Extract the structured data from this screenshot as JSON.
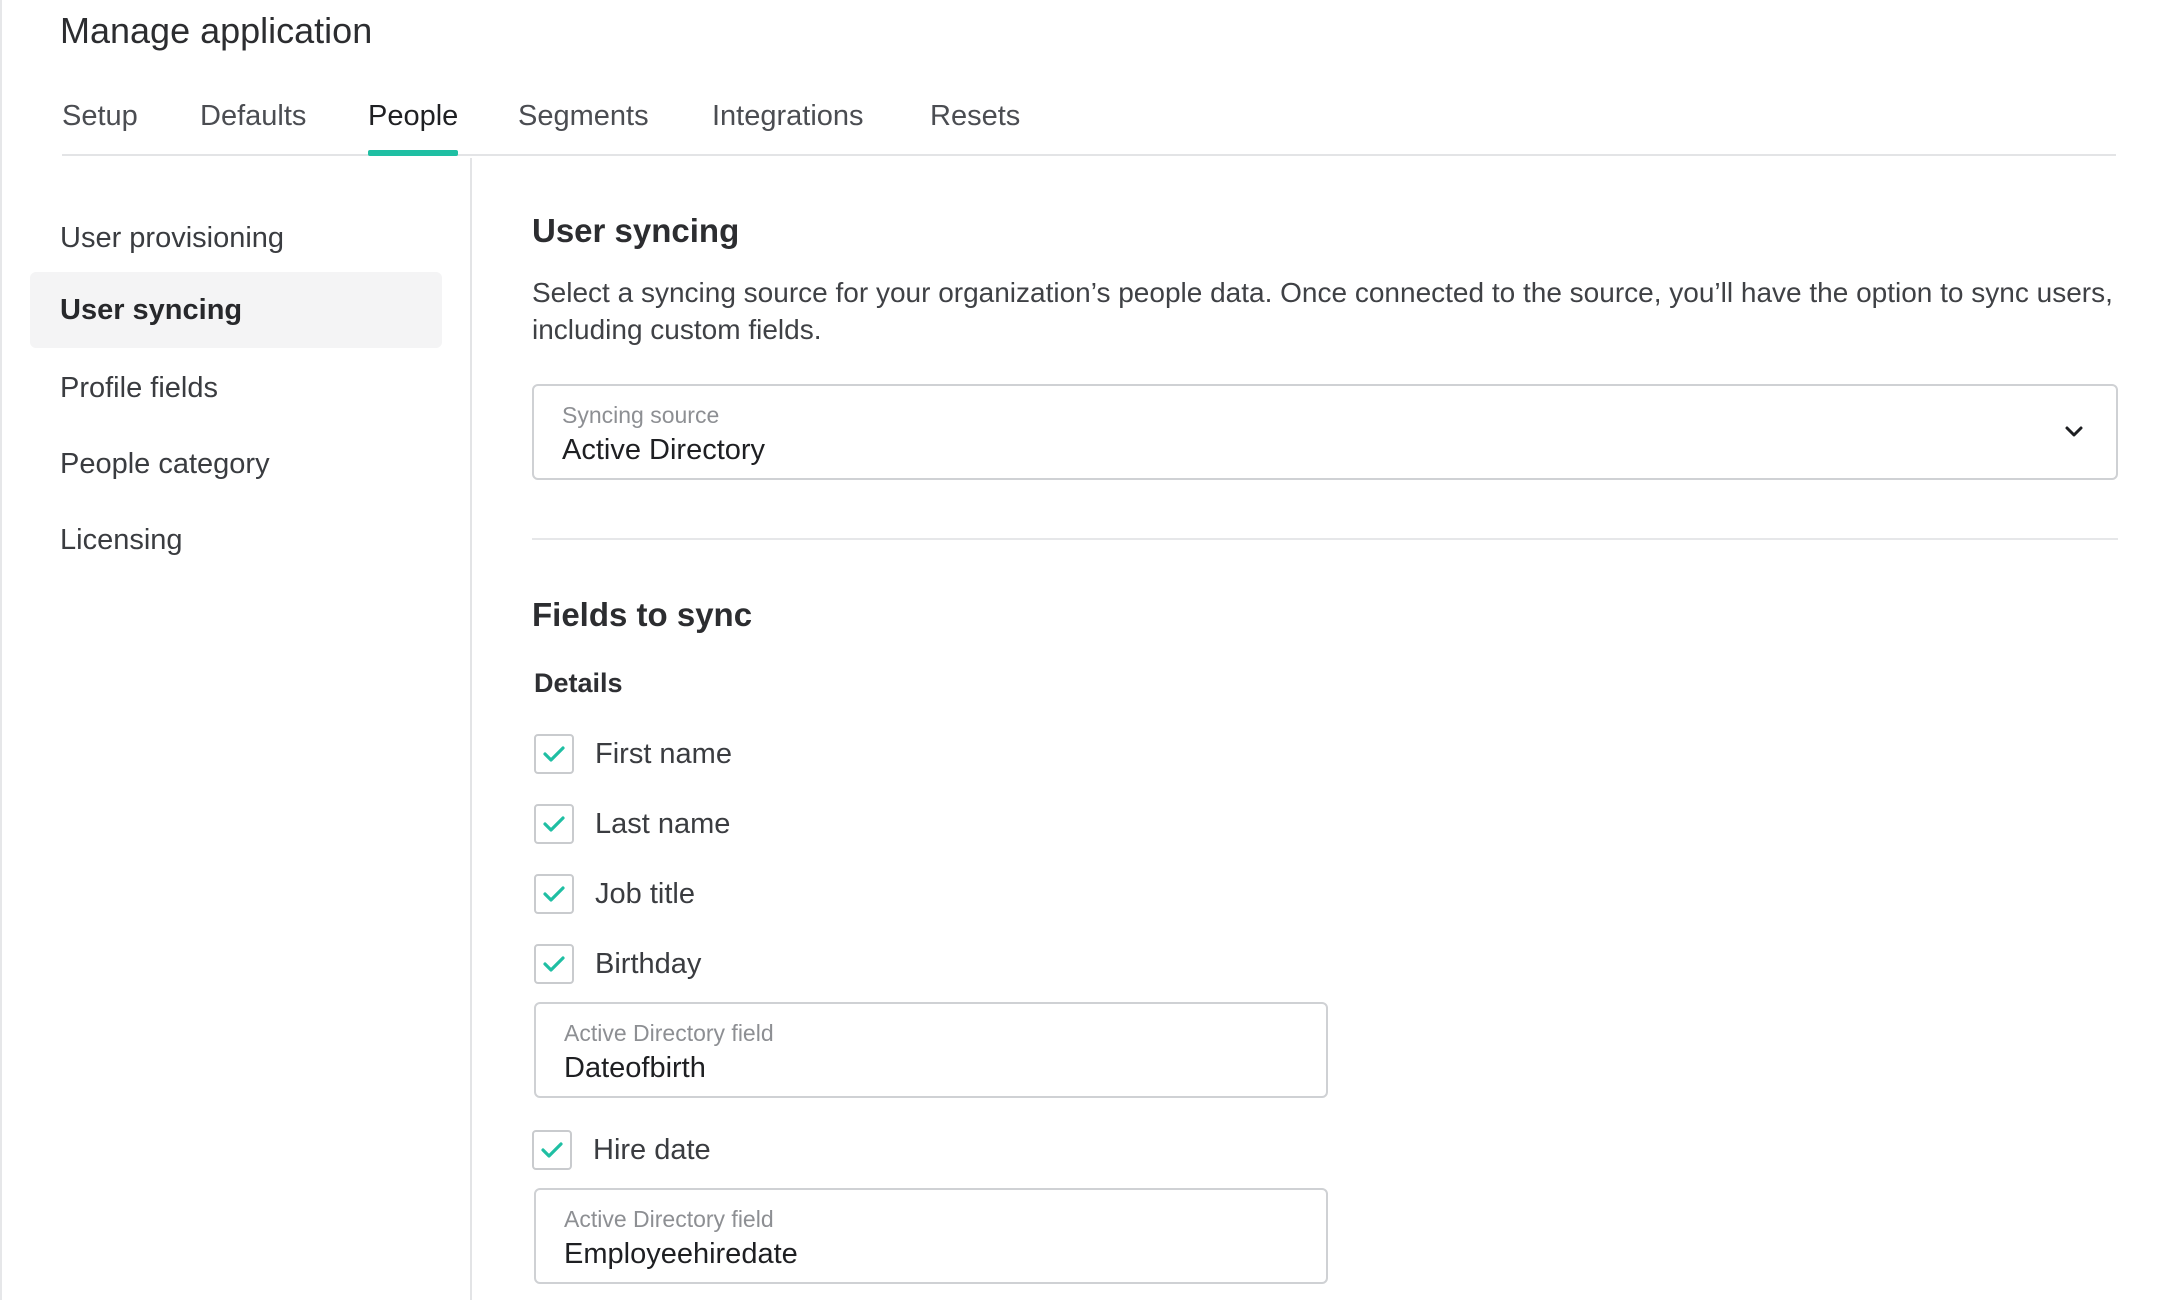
{
  "page": {
    "title": "Manage application"
  },
  "tabs": [
    {
      "label": "Setup"
    },
    {
      "label": "Defaults"
    },
    {
      "label": "People"
    },
    {
      "label": "Segments"
    },
    {
      "label": "Integrations"
    },
    {
      "label": "Resets"
    }
  ],
  "active_tab": "People",
  "sidebar": {
    "items": [
      {
        "label": "User provisioning"
      },
      {
        "label": "User syncing"
      },
      {
        "label": "Profile fields"
      },
      {
        "label": "People category"
      },
      {
        "label": "Licensing"
      }
    ],
    "active_item": "User syncing"
  },
  "user_syncing": {
    "title": "User syncing",
    "description": "Select a syncing source for your organization’s people data. Once connected to the source, you’ll have the option to sync users, including custom fields.",
    "source_label": "Syncing source",
    "source_value": "Active Directory"
  },
  "fields_to_sync": {
    "title": "Fields to sync",
    "details_label": "Details",
    "checkboxes": [
      {
        "label": "First name",
        "checked": true
      },
      {
        "label": "Last name",
        "checked": true
      },
      {
        "label": "Job title",
        "checked": true
      },
      {
        "label": "Birthday",
        "checked": true
      },
      {
        "label": "Hire date",
        "checked": true
      }
    ],
    "birthday_field": {
      "label": "Active Directory field",
      "value": "Dateofbirth"
    },
    "hire_date_field": {
      "label": "Active Directory field",
      "value": "Employeehiredate"
    }
  },
  "colors": {
    "accent": "#1fbfa3",
    "border": "#cfd1d4",
    "active_bg": "#f4f4f5"
  }
}
